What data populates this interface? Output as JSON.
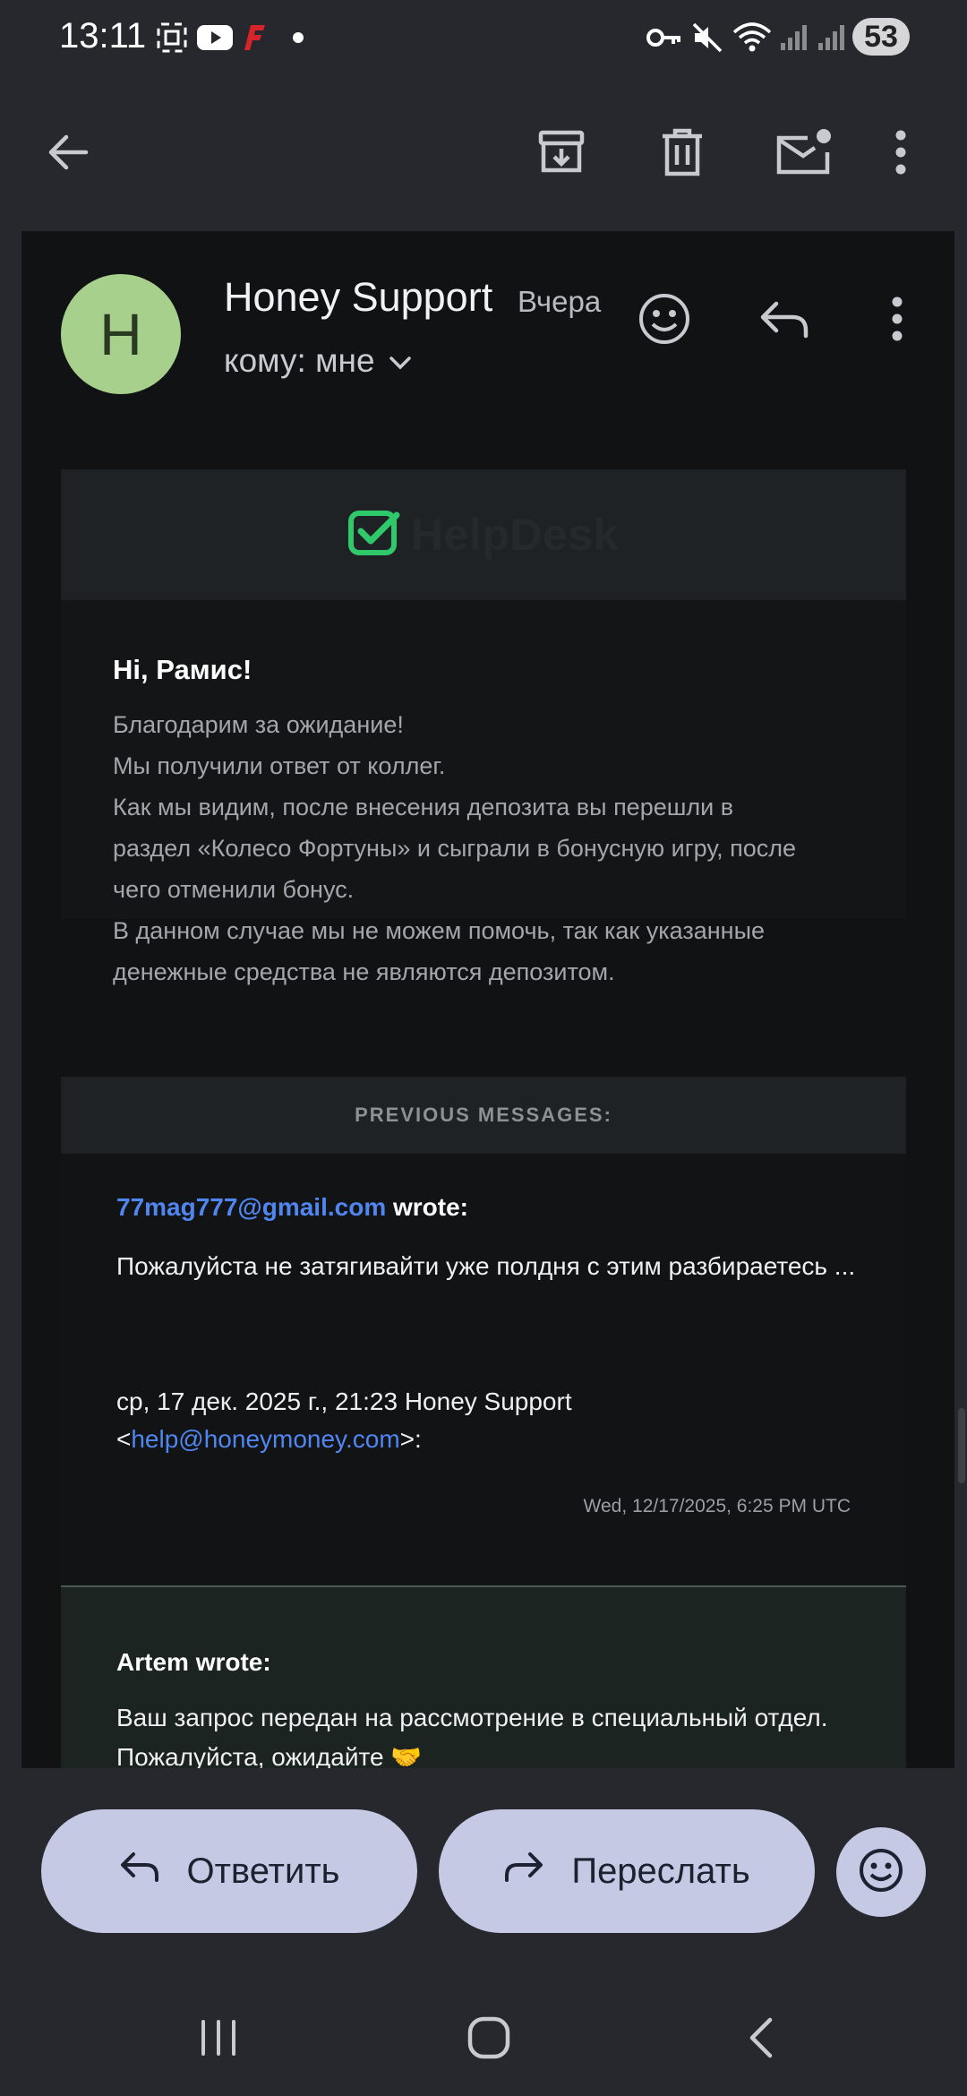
{
  "status_bar": {
    "time": "13:11",
    "battery": "53",
    "icons": [
      "screenshot-icon",
      "youtube-icon",
      "f-app-icon",
      "dot-icon",
      "key-icon",
      "mute-icon",
      "wifi-icon",
      "signal-icon",
      "signal-icon-2"
    ]
  },
  "top_bar": {
    "icons": [
      "back-arrow-icon",
      "archive-icon",
      "trash-icon",
      "mark-unread-icon",
      "more-vert-icon"
    ]
  },
  "email": {
    "avatar_letter": "H",
    "sender": "Honey Support",
    "when": "Вчера",
    "to": "кому: мне",
    "banner_text": "HelpDesk",
    "greeting": "Hi, Рамис!",
    "body_lines": [
      "Благодарим за ожидание!",
      "Мы получили ответ от коллег.",
      "Как мы видим, после внесения депозита вы перешли в",
      "раздел «Колесо Фортуны» и сыграли в бонусную игру, после",
      "чего отменили бонус.",
      "В данном случае мы не можем помочь, так как указанные",
      "денежные средства не являются депозитом."
    ],
    "previous_header": "PREVIOUS MESSAGES:"
  },
  "quote1": {
    "email": "77mag777@gmail.com",
    "wrote": " wrote:",
    "text": "Пожалуйста не затягивайти уже полдня с этим разбираетесь ...",
    "meta_prefix": "ср, 17 дек. 2025 г., 21:23 Honey Support",
    "meta_lt": "<",
    "meta_email": "help@honeymoney.com",
    "meta_suffix": ">:",
    "timestamp": "Wed, 12/17/2025, 6:25 PM UTC"
  },
  "quote2": {
    "author": "Artem wrote:",
    "text": "Ваш запрос передан на рассмотрение в специальный отдел. Пожалуйста, ожидайте 🤝"
  },
  "actions": {
    "reply": "Ответить",
    "forward": "Переслать"
  },
  "colors": {
    "background": "#26282d",
    "content": "#111214",
    "avatar": "#a8d08d",
    "link": "#4f86f0",
    "pill": "#c5c9e3",
    "helpdesk_green": "#2fc86a"
  }
}
